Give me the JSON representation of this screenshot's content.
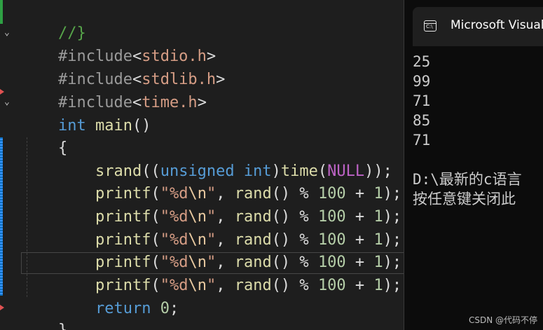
{
  "editor": {
    "line_comment": "//}",
    "includes": [
      {
        "directive": "#include",
        "open": "<",
        "file": "stdio.h",
        "close": ">"
      },
      {
        "directive": "#include",
        "open": "<",
        "file": "stdlib.h",
        "close": ">"
      },
      {
        "directive": "#include",
        "open": "<",
        "file": "time.h",
        "close": ">"
      }
    ],
    "main_type": "int",
    "main_name": "main",
    "main_parens": "()",
    "brace_open": "{",
    "brace_close": "}",
    "srand": {
      "fn": "srand",
      "p1": "((",
      "kw1": "unsigned",
      "kw2": "int",
      "p2": ")",
      "fn2": "time",
      "p3": "(",
      "macro": "NULL",
      "p4": "));"
    },
    "printf_lines": [
      {
        "fn": "printf",
        "p_open": "(",
        "str1": "\"%d",
        "esc": "\\n",
        "str2": "\"",
        "comma": ", ",
        "rand": "rand",
        "rp": "()",
        "op": " % ",
        "n1": "100",
        "plus": " + ",
        "n2": "1",
        "end": ");"
      },
      {
        "fn": "printf",
        "p_open": "(",
        "str1": "\"%d",
        "esc": "\\n",
        "str2": "\"",
        "comma": ", ",
        "rand": "rand",
        "rp": "()",
        "op": " % ",
        "n1": "100",
        "plus": " + ",
        "n2": "1",
        "end": ");"
      },
      {
        "fn": "printf",
        "p_open": "(",
        "str1": "\"%d",
        "esc": "\\n",
        "str2": "\"",
        "comma": ", ",
        "rand": "rand",
        "rp": "()",
        "op": " % ",
        "n1": "100",
        "plus": " + ",
        "n2": "1",
        "end": ");"
      },
      {
        "fn": "printf",
        "p_open": "(",
        "str1": "\"%d",
        "esc": "\\n",
        "str2": "\"",
        "comma": ", ",
        "rand": "rand",
        "rp": "()",
        "op": " % ",
        "n1": "100",
        "plus": " + ",
        "n2": "1",
        "end": ");"
      },
      {
        "fn": "printf",
        "p_open": "(",
        "str1": "\"%d",
        "esc": "\\n",
        "str2": "\"",
        "comma": ", ",
        "rand": "rand",
        "rp": "()",
        "op": " % ",
        "n1": "100",
        "plus": " + ",
        "n2": "1",
        "end": ");"
      }
    ],
    "return_kw": "return",
    "return_val": "0",
    "return_end": ";",
    "fold_glyph": "⌄"
  },
  "console": {
    "icon": "cmd-icon",
    "icon_text": "C:\\",
    "title": "Microsoft Visual",
    "output": [
      "25",
      "99",
      "71",
      "85",
      "71"
    ],
    "path_line": "D:\\最新的c语言",
    "prompt_line": "按任意键关闭此"
  },
  "watermark": "CSDN @代码不停",
  "colors": {
    "editor_bg": "#1e1e1e",
    "console_bg": "#0c0c0c",
    "keyword": "#569cd6",
    "function": "#dcdcaa",
    "string": "#d69d85",
    "number": "#b5cea8",
    "macro": "#bd63c5",
    "comment": "#57a64a"
  }
}
